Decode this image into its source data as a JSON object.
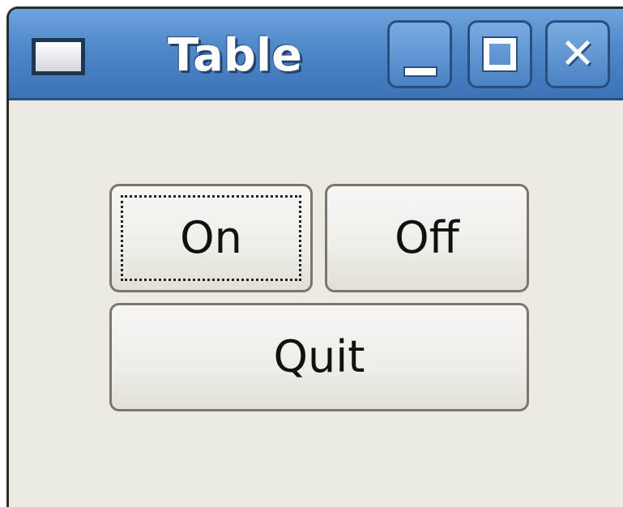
{
  "window": {
    "title": "Table",
    "icon": "window-icon",
    "controls": {
      "minimize_icon": "minimize-icon",
      "maximize_icon": "maximize-icon",
      "close_icon": "close-icon",
      "close_glyph": "✕"
    }
  },
  "buttons": {
    "on_label": "On",
    "off_label": "Off",
    "quit_label": "Quit"
  },
  "colors": {
    "titlebar": "#4f87c9",
    "background": "#edeae3"
  }
}
